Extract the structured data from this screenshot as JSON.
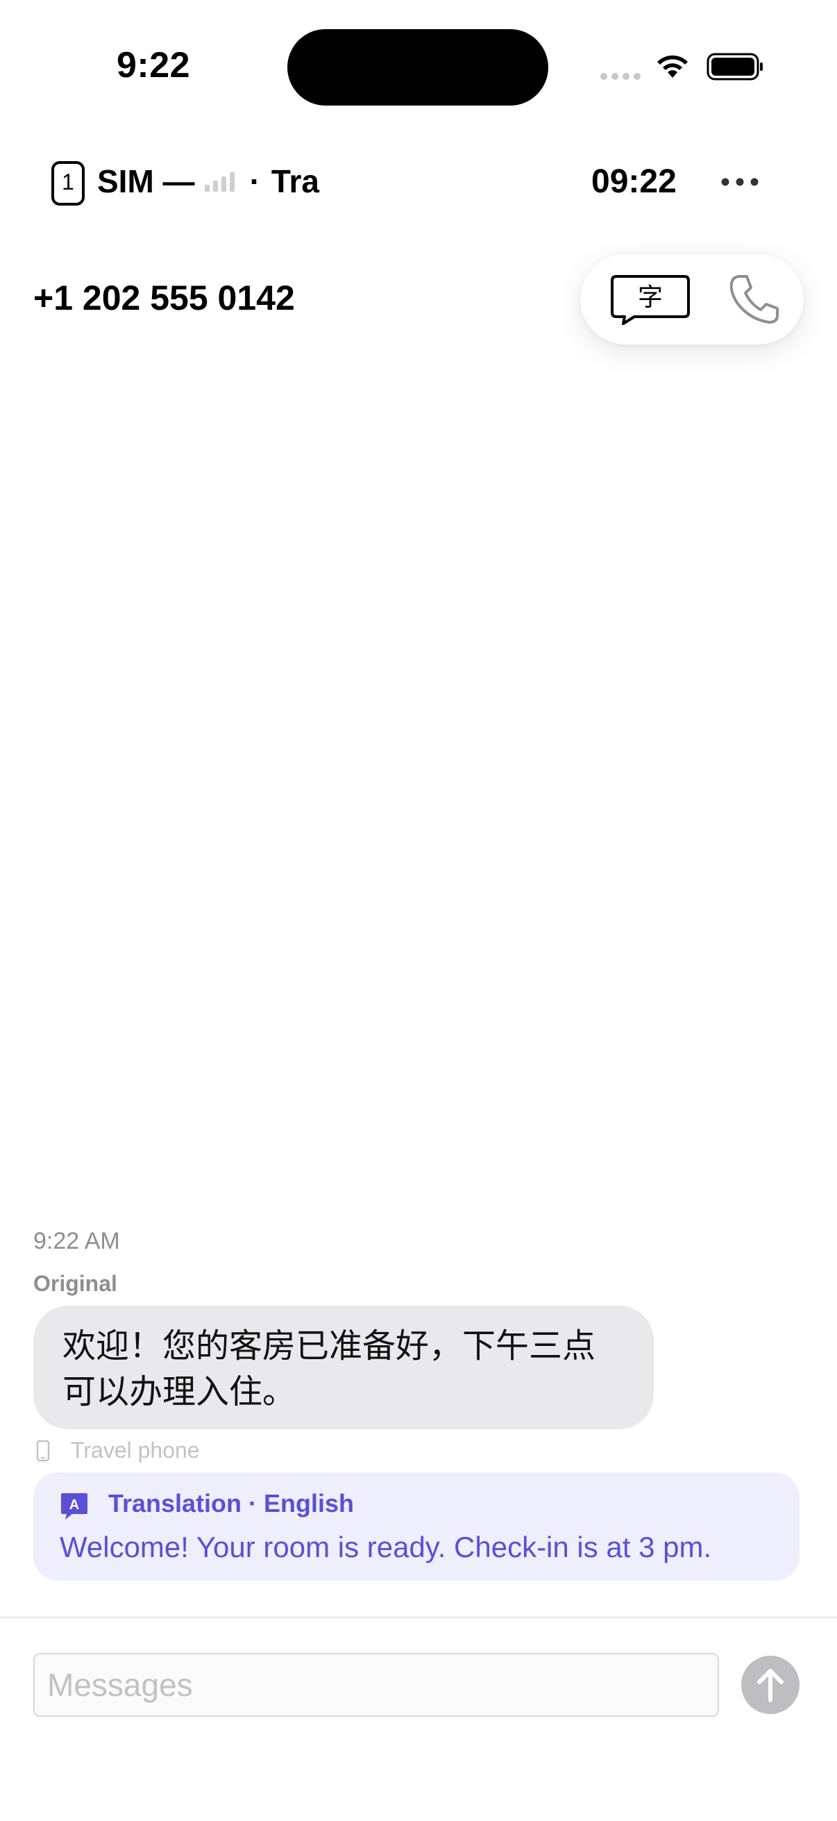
{
  "status_bar": {
    "time": "9:22",
    "icons": [
      "cellular-dots-icon",
      "wifi-icon",
      "battery-icon"
    ]
  },
  "header": {
    "sim_badge": "1",
    "sim_text": "SIM —",
    "sim_suffix": "Tra",
    "separator": "·",
    "time": "09:22",
    "more_icon": "ellipsis-icon"
  },
  "contact": {
    "phone_number": "+1 202 555 0142",
    "translate_glyph": "字",
    "actions": [
      "translate-message-icon",
      "phone-icon"
    ]
  },
  "conversation": {
    "timestamp": "9:22 AM",
    "original_label": "Original",
    "original_message": "欢迎！您的客房已准备好，下午三点可以办理入住。",
    "line_label": "Travel phone",
    "translation": {
      "icon_letter": "A",
      "label": "Translation · English",
      "text": "Welcome! Your room is ready. Check-in is at 3 pm."
    }
  },
  "composer": {
    "placeholder": "Messages",
    "value": ""
  },
  "colors": {
    "accent": "#5b4fd6",
    "translation_bg": "#eeeefd",
    "bubble_bg": "#e9e9eb",
    "muted_text": "#8e8e93"
  }
}
